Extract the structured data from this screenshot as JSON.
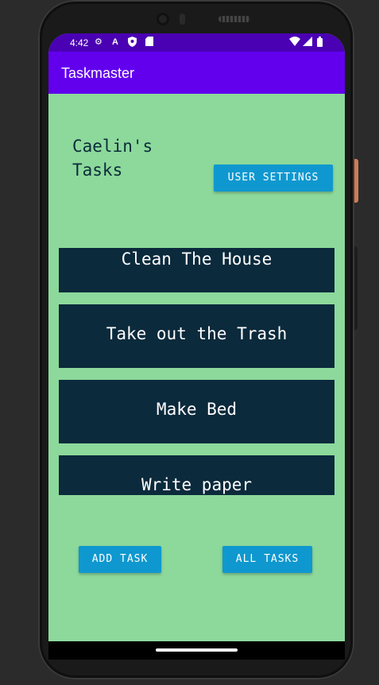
{
  "status_bar": {
    "time": "4:42",
    "left_icons": [
      "gear-icon",
      "a-icon",
      "shield-icon",
      "sd-card-icon"
    ],
    "right_icons": [
      "wifi-icon",
      "signal-icon",
      "battery-icon"
    ]
  },
  "app_bar": {
    "title": "Taskmaster"
  },
  "main": {
    "heading": "Caelin's Tasks",
    "user_settings_label": "USER SETTINGS",
    "tasks": [
      {
        "label": "Clean The House"
      },
      {
        "label": "Take out the Trash"
      },
      {
        "label": "Make Bed"
      },
      {
        "label": "Write paper"
      }
    ],
    "add_task_label": "ADD TASK",
    "all_tasks_label": "ALL TASKS"
  },
  "colors": {
    "status_bar": "#4a00b3",
    "app_bar": "#6200ee",
    "background": "#8cd99b",
    "task_bg": "#0b2a3c",
    "button": "#0f98cf"
  }
}
